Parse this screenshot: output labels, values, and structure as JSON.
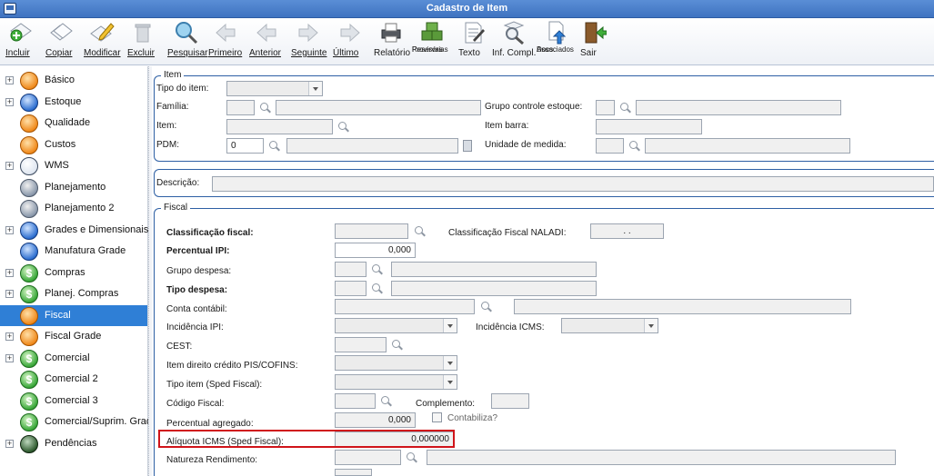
{
  "window": {
    "title": "Cadastro de Item"
  },
  "toolbar": {
    "incluir": "Incluir",
    "copiar": "Copiar",
    "modificar": "Modificar",
    "excluir": "Excluir",
    "pesquisar": "Pesquisar",
    "primeiro": "Primeiro",
    "anterior": "Anterior",
    "seguinte": "Seguinte",
    "ultimo": "Último",
    "relatorio": "Relatório",
    "reservas_l1": "Reservas",
    "reservas_l2": "Provisórias",
    "texto": "Texto",
    "inf_compl": "Inf. Compl.",
    "docs_l1": "Docs.",
    "docs_l2": "Associados",
    "sair": "Sair"
  },
  "sidebar": {
    "items": [
      {
        "label": "Básico"
      },
      {
        "label": "Estoque"
      },
      {
        "label": "Qualidade"
      },
      {
        "label": "Custos"
      },
      {
        "label": "WMS"
      },
      {
        "label": "Planejamento"
      },
      {
        "label": "Planejamento 2"
      },
      {
        "label": "Grades e Dimensionais"
      },
      {
        "label": "Manufatura Grade"
      },
      {
        "label": "Compras"
      },
      {
        "label": "Planej. Compras"
      },
      {
        "label": "Fiscal"
      },
      {
        "label": "Fiscal Grade"
      },
      {
        "label": "Comercial"
      },
      {
        "label": "Comercial 2"
      },
      {
        "label": "Comercial 3"
      },
      {
        "label": "Comercial/Suprim. Grade"
      },
      {
        "label": "Pendências"
      }
    ],
    "selected": "Fiscal"
  },
  "item_group": {
    "title": "Item",
    "tipo_do_item": "Tipo do item:",
    "familia": "Família:",
    "grupo_controle_estoque": "Grupo controle estoque:",
    "item": "Item:",
    "item_barra": "Item barra:",
    "pdm": "PDM:",
    "pdm_value": "0",
    "unidade_de_medida": "Unidade de medida:"
  },
  "descricao": {
    "label": "Descrição:"
  },
  "fiscal_group": {
    "title": "Fiscal",
    "classificacao_fiscal": "Classificação fiscal:",
    "classificacao_fiscal_naladi": "Classificação Fiscal NALADI:",
    "naladi_value": ". .",
    "percentual_ipi": "Percentual IPI:",
    "percentual_ipi_value": "0,000",
    "grupo_despesa": "Grupo despesa:",
    "tipo_despesa": "Tipo despesa:",
    "conta_contabil": "Conta contábil:",
    "incidencia_ipi": "Incidência IPI:",
    "incidencia_icms": "Incidência ICMS:",
    "cest": "CEST:",
    "item_direito_credito": "Item direito crédito PIS/COFINS:",
    "tipo_item_sped": "Tipo item (Sped Fiscal):",
    "codigo_fiscal": "Código Fiscal:",
    "complemento": "Complemento:",
    "percentual_agregado": "Percentual agregado:",
    "percentual_agregado_value": "0,000",
    "contabiliza": "Contabiliza?",
    "aliquota_icms": "Alíquota ICMS (Sped Fiscal):",
    "aliquota_icms_value": "0,000000",
    "natureza_rendimento": "Natureza Rendimento:"
  },
  "colors": {
    "highlight": "#d0141a",
    "selected_nav": "#2f7fd6",
    "titlebar": "#3f73c0"
  }
}
